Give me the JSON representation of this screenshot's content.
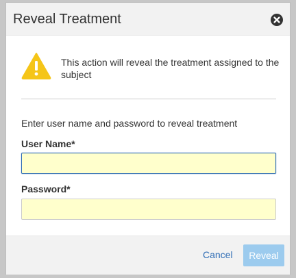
{
  "dialog": {
    "title": "Reveal Treatment",
    "close_icon": "close-circle-icon"
  },
  "warning": {
    "icon": "warning-triangle-icon",
    "text": "This action will reveal the treatment assigned to the subject",
    "color": "#f5c518"
  },
  "form": {
    "instruction": "Enter user name and password to reveal treatment",
    "username_label": "User Name*",
    "username_value": "",
    "password_label": "Password*",
    "password_value": ""
  },
  "footer": {
    "cancel_label": "Cancel",
    "reveal_label": "Reveal"
  },
  "colors": {
    "accent": "#2f6db5",
    "reveal_disabled": "#9ccbee",
    "field_bg": "#ffffcc"
  }
}
